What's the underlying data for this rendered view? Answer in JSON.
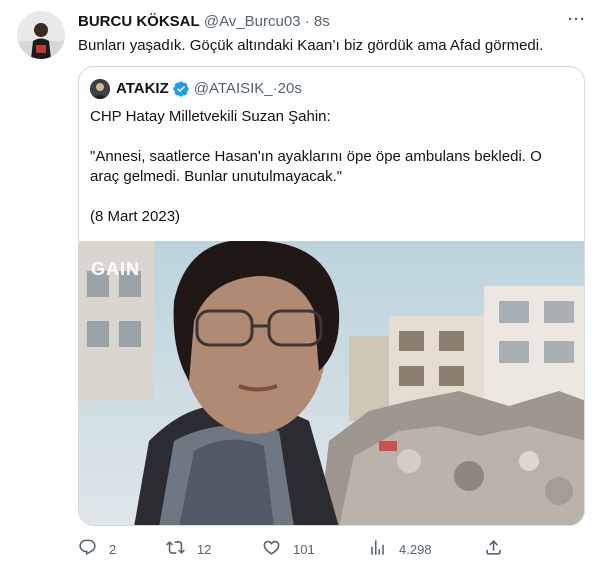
{
  "tweet": {
    "author_name": "BURCU KÖKSAL",
    "author_handle": "@Av_Burcu03",
    "separator": " · ",
    "time": "8s",
    "text": "Bunları yaşadık. Göçük altındaki Kaan’ı biz gördük ama Afad görmedi.",
    "more_label": "···"
  },
  "quote": {
    "author_name": "ATAKIZ",
    "author_handle": "@ATAISIK_",
    "separator": " · ",
    "time": "20s",
    "lines": [
      "CHP Hatay Milletvekili Suzan Şahin:",
      "",
      "\"Annesi, saatlerce Hasan'ın ayaklarını öpe öpe ambulans bekledi. O",
      "araç gelmedi. Bunlar unutulmayacak.\"",
      "",
      "(8 Mart 2023)"
    ],
    "media_watermark": "GAIN"
  },
  "actions": {
    "reply_count": "2",
    "retweet_count": "12",
    "like_count": "101",
    "views_count": "4.298"
  },
  "colors": {
    "text": "#0f1419",
    "secondary": "#536471",
    "border": "#cfd9de",
    "verified": "#1d9bf0"
  },
  "icons": {
    "reply": "reply-icon",
    "retweet": "retweet-icon",
    "like": "heart-icon",
    "views": "views-icon",
    "share": "share-icon",
    "verified": "verified-badge-icon",
    "more": "more-icon"
  }
}
